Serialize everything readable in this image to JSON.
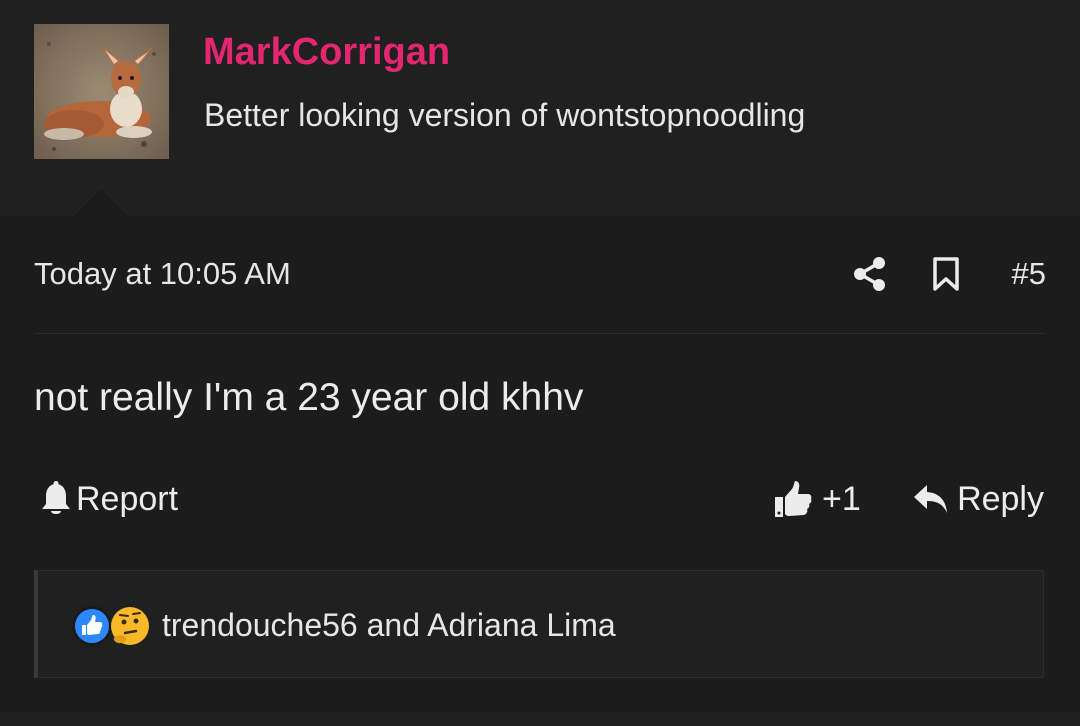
{
  "user": {
    "name": "MarkCorrigan",
    "title": "Better looking version of wontstopnoodling",
    "name_color": "#e3266f",
    "avatar_icon": "kangaroo-photo"
  },
  "message": {
    "timestamp": "Today at 10:05 AM",
    "post_number": "#5",
    "body": "not really I'm a 23 year old khhv"
  },
  "actions": {
    "report_label": "Report",
    "like_label": "+1",
    "reply_label": "Reply",
    "share_icon": "share-icon",
    "bookmark_icon": "bookmark-icon"
  },
  "reactions": {
    "text": "trendouche56 and Adriana Lima",
    "icons": [
      "like-reaction-icon",
      "thinking-face-icon"
    ]
  },
  "colors": {
    "background": "#1c1c1c",
    "header_background": "#202020",
    "text": "#e9e9e9",
    "accent": "#e3266f"
  }
}
